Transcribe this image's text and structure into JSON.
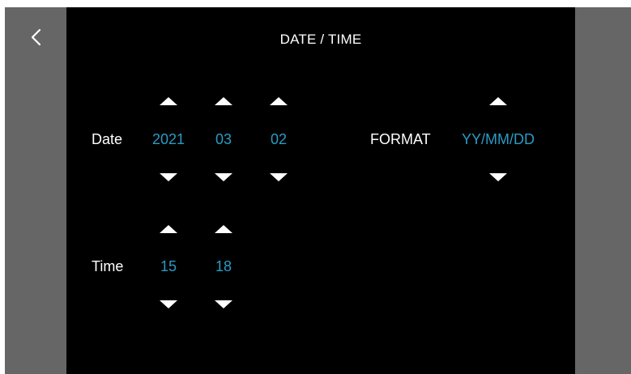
{
  "header": {
    "title": "DATE / TIME",
    "back_icon": "chevron-left-icon"
  },
  "date": {
    "label": "Date",
    "year": "2021",
    "month": "03",
    "day": "02"
  },
  "time": {
    "label": "Time",
    "hour": "15",
    "minute": "18"
  },
  "format": {
    "label": "FORMAT",
    "value": "YY/MM/DD"
  },
  "colors": {
    "background": "#000000",
    "side_panel": "#666666",
    "text": "#ffffff",
    "value_accent": "#2a9bc4"
  }
}
